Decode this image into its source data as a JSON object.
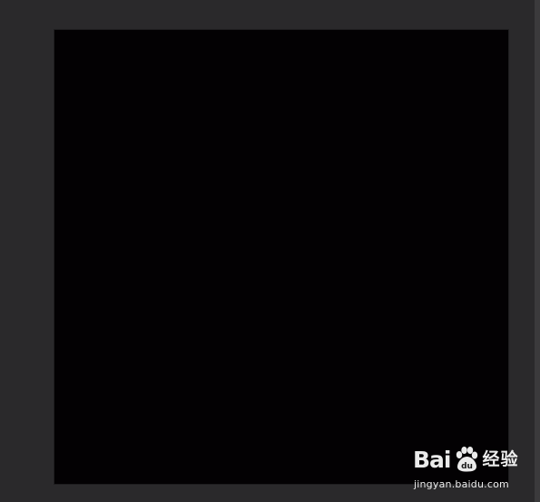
{
  "watermark": {
    "brand_prefix": "Bai",
    "brand_du": "du",
    "brand_suffix": "经验",
    "url": "jingyan.baidu.com"
  },
  "colors": {
    "workspace_bg": "#2a292b",
    "canvas_fill": "#030103",
    "watermark_text": "#ffffff"
  },
  "icons": {
    "logo": "baidu-paw-icon"
  }
}
